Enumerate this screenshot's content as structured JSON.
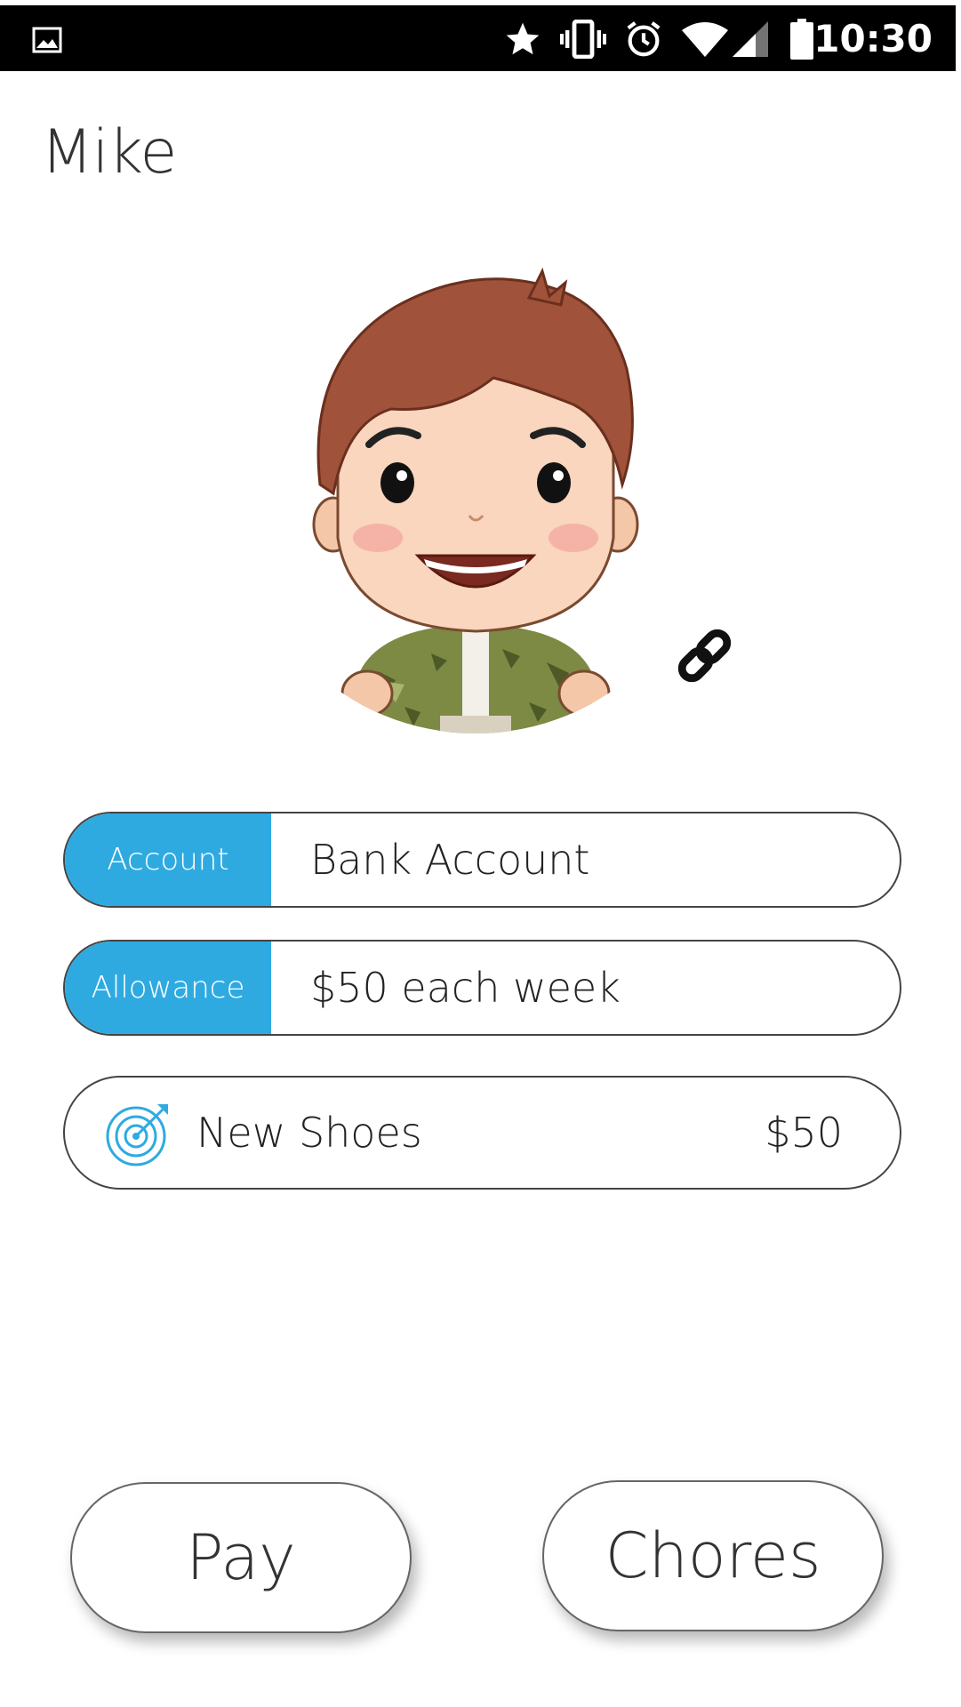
{
  "status_bar": {
    "time": "10:30",
    "icons": [
      "gallery-icon",
      "star-icon",
      "vibrate-icon",
      "alarm-icon",
      "wifi-icon",
      "signal-icon",
      "battery-icon"
    ]
  },
  "profile": {
    "name": "Mike",
    "avatar_icon": "boy-avatar",
    "link_icon": "link-icon"
  },
  "fields": [
    {
      "tag": "Account",
      "value": "Bank Account"
    },
    {
      "tag": "Allowance",
      "value": "$50 each week"
    }
  ],
  "goal": {
    "icon": "target-icon",
    "name": "New Shoes",
    "amount": "$50"
  },
  "actions": {
    "pay_label": "Pay",
    "chores_label": "Chores"
  },
  "colors": {
    "accent": "#2eaae1",
    "status_bar": "#000000",
    "background": "#ffffff"
  }
}
